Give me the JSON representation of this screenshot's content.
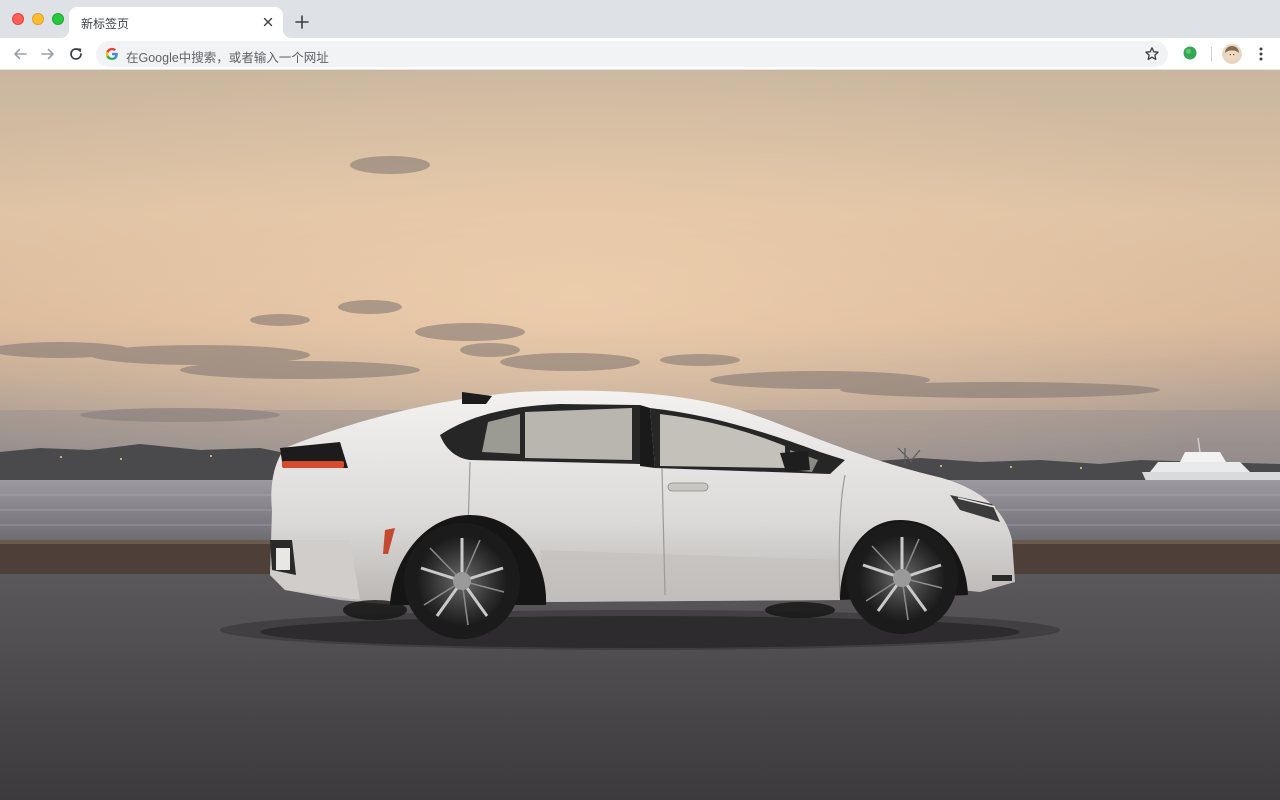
{
  "window": {
    "traffic_lights": [
      "close",
      "minimize",
      "maximize"
    ]
  },
  "tab": {
    "title": "新标签页"
  },
  "omnibox": {
    "placeholder": "在Google中搜索，或者输入一个网址"
  },
  "toolbar": {
    "back_icon": "arrow-left-icon",
    "forward_icon": "arrow-right-icon",
    "reload_icon": "reload-icon",
    "bookmark_icon": "star-icon",
    "extension_icon": "extension-icon",
    "profile_icon": "avatar",
    "menu_icon": "kebab-menu-icon"
  },
  "background": {
    "subject": "car-photo"
  },
  "colors": {
    "tabstrip": "#dee1e6",
    "omnibox": "#f1f3f4",
    "extension_green": "#34a853"
  }
}
